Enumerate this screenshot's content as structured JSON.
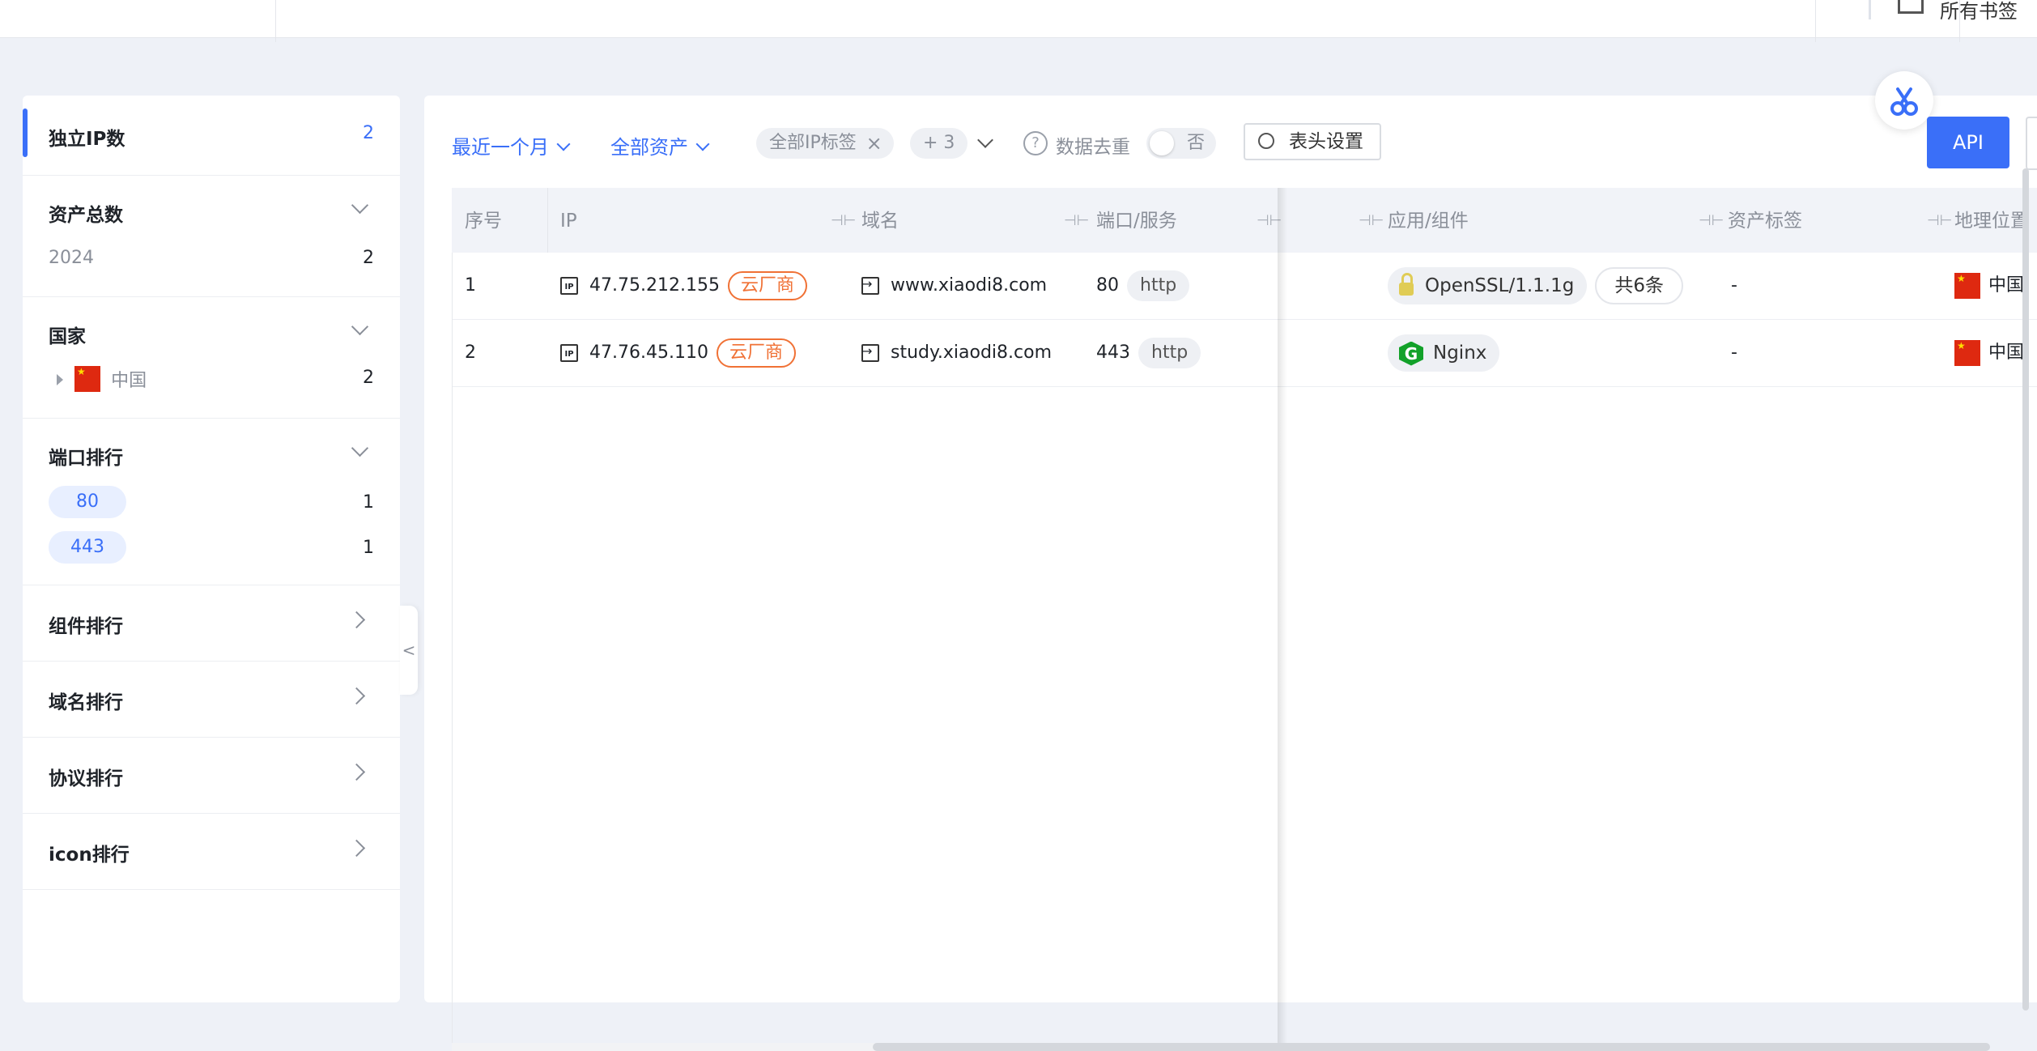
{
  "topbar": {
    "bookmark_label": "所有书签"
  },
  "sidebar": {
    "unique_ip": {
      "title": "独立IP数",
      "count": "2"
    },
    "asset_total": {
      "title": "资产总数",
      "year": "2024",
      "year_count": "2"
    },
    "country": {
      "title": "国家",
      "items": [
        {
          "label": "中国",
          "count": "2"
        }
      ]
    },
    "port_rank": {
      "title": "端口排行",
      "items": [
        {
          "port": "80",
          "count": "1"
        },
        {
          "port": "443",
          "count": "1"
        }
      ]
    },
    "component_rank": {
      "title": "组件排行"
    },
    "domain_rank": {
      "title": "域名排行"
    },
    "protocol_rank": {
      "title": "协议排行"
    },
    "icon_rank": {
      "title": "icon排行"
    },
    "collapse_symbol": "<"
  },
  "toolbar": {
    "time_filter": "最近一个月",
    "asset_filter": "全部资产",
    "ip_tag_chip": "全部IP标签",
    "ip_tag_close": "×",
    "more_chip": "+ 3",
    "dedup_label": "数据去重",
    "dedup_help": "?",
    "dedup_value": "否",
    "header_settings": "表头设置",
    "api_button": "API"
  },
  "table": {
    "headers": {
      "seq": "序号",
      "ip": "IP",
      "domain": "域名",
      "port": "端口/服务",
      "app": "应用/组件",
      "tags": "资产标签",
      "geo": "地理位置"
    },
    "rows": [
      {
        "seq": "1",
        "ip": "47.75.212.155",
        "ip_tag": "云厂商",
        "domain": "www.xiaodi8.com",
        "port": "80",
        "service": "http",
        "component": "OpenSSL/1.1.1g",
        "component_more": "共6条",
        "asset_tag": "-",
        "geo": "中国"
      },
      {
        "seq": "2",
        "ip": "47.76.45.110",
        "ip_tag": "云厂商",
        "domain": "study.xiaodi8.com",
        "port": "443",
        "service": "http",
        "component": "Nginx",
        "asset_tag": "-",
        "geo": "中国"
      }
    ],
    "ip_icon_text": "IP",
    "nginx_icon_text": "G"
  },
  "colors": {
    "accent": "#3a6ff8",
    "cloud_tag": "#f07135",
    "nginx": "#12a129",
    "lock": "#e0cc55"
  }
}
